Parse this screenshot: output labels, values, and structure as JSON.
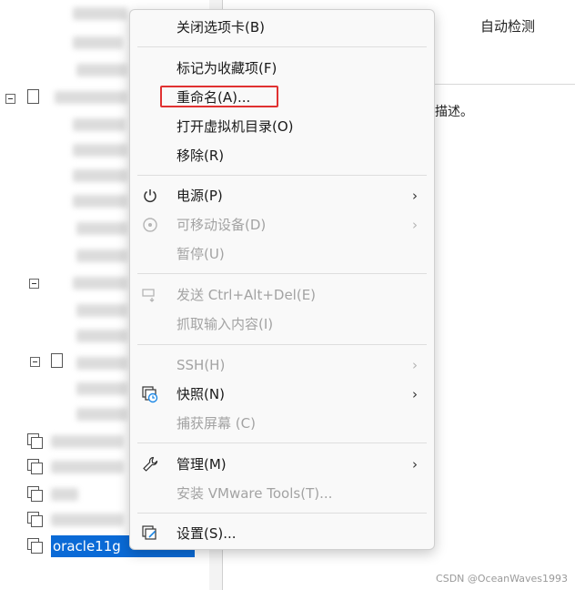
{
  "detail": {
    "auto_detect": "自动检测",
    "description_fragment": "描述。"
  },
  "tree": {
    "selected_vm": "oracle11g"
  },
  "context_menu": {
    "items": [
      {
        "label": "关闭选项卡(B)",
        "enabled": true
      },
      {
        "label": "标记为收藏项(F)",
        "enabled": true
      },
      {
        "label": "重命名(A)...",
        "enabled": true,
        "highlighted": true
      },
      {
        "label": "打开虚拟机目录(O)",
        "enabled": true
      },
      {
        "label": "移除(R)",
        "enabled": true
      },
      {
        "label": "电源(P)",
        "enabled": true,
        "icon": "power-icon",
        "submenu": true
      },
      {
        "label": "可移动设备(D)",
        "enabled": false,
        "icon": "removable-device-icon",
        "submenu": true
      },
      {
        "label": "暂停(U)",
        "enabled": false
      },
      {
        "label": "发送 Ctrl+Alt+Del(E)",
        "enabled": false,
        "icon": "send-keys-icon"
      },
      {
        "label": "抓取输入内容(I)",
        "enabled": false
      },
      {
        "label": "SSH(H)",
        "enabled": false,
        "submenu": true
      },
      {
        "label": "快照(N)",
        "enabled": true,
        "icon": "snapshot-icon",
        "submenu": true
      },
      {
        "label": "捕获屏幕 (C)",
        "enabled": false
      },
      {
        "label": "管理(M)",
        "enabled": true,
        "icon": "wrench-icon",
        "submenu": true
      },
      {
        "label": "安装 VMware Tools(T)...",
        "enabled": false
      },
      {
        "label": "设置(S)...",
        "enabled": true,
        "icon": "settings-icon"
      }
    ],
    "submenu_arrow": "›",
    "highlight_color": "#e03131"
  },
  "watermark": "CSDN @OceanWaves1993",
  "colors": {
    "selection": "#0a6ad6",
    "menu_bg": "#f9f9f9",
    "disabled_text": "#a3a3a3",
    "snapshot_accent": "#1e88e5"
  }
}
